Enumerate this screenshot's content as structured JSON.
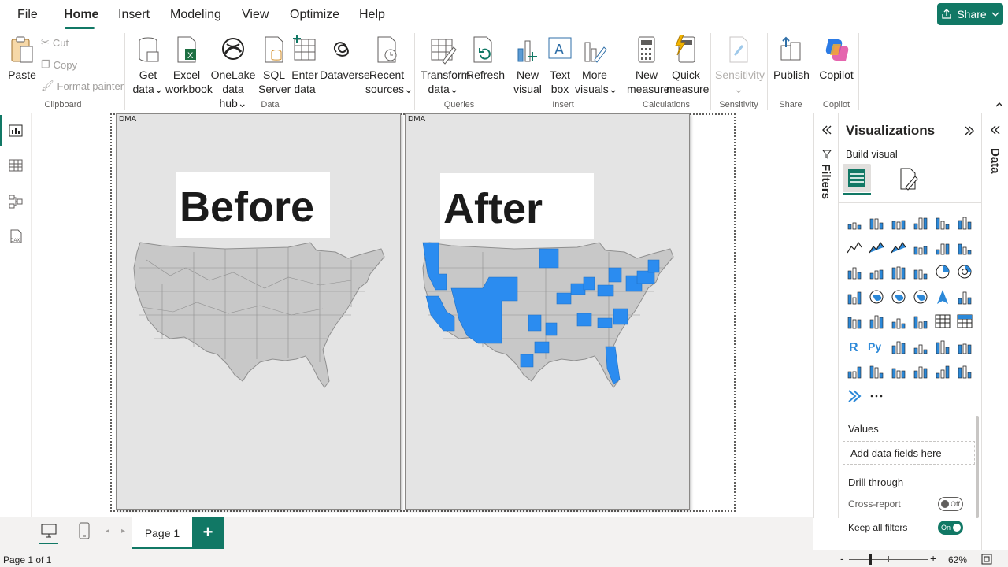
{
  "menu": {
    "file": "File",
    "home": "Home",
    "insert": "Insert",
    "modeling": "Modeling",
    "view": "View",
    "optimize": "Optimize",
    "help": "Help",
    "share": "Share"
  },
  "ribbon": {
    "paste": "Paste",
    "cut": "Cut",
    "copy": "Copy",
    "format_painter": "Format painter",
    "clipboard": "Clipboard",
    "get_data_1": "Get",
    "get_data_2": "data",
    "excel_1": "Excel",
    "excel_2": "workbook",
    "onelake_1": "OneLake",
    "onelake_2": "data hub",
    "sql_1": "SQL",
    "sql_2": "Server",
    "enter_1": "Enter",
    "enter_2": "data",
    "dataverse": "Dataverse",
    "recent_1": "Recent",
    "recent_2": "sources",
    "data_group": "Data",
    "transform_1": "Transform",
    "transform_2": "data",
    "refresh": "Refresh",
    "queries": "Queries",
    "new_visual_1": "New",
    "new_visual_2": "visual",
    "text_box_1": "Text",
    "text_box_2": "box",
    "more_visuals_1": "More",
    "more_visuals_2": "visuals",
    "insert_group": "Insert",
    "new_measure_1": "New",
    "new_measure_2": "measure",
    "quick_measure_1": "Quick",
    "quick_measure_2": "measure",
    "calculations": "Calculations",
    "sensitivity": "Sensitivity",
    "sensitivity_group": "Sensitivity",
    "publish": "Publish",
    "share_group": "Share",
    "copilot": "Copilot",
    "copilot_group": "Copilot"
  },
  "visuals": {
    "left": {
      "title": "DMA",
      "label": "Before"
    },
    "right": {
      "title": "DMA",
      "label": "After"
    }
  },
  "panes": {
    "filters": "Filters",
    "visualizations": "Visualizations",
    "build_visual": "Build visual",
    "data": "Data",
    "values": "Values",
    "add_data": "Add data fields here",
    "drill_through": "Drill through",
    "cross_report": "Cross-report",
    "cross_report_state": "Off",
    "keep_filters": "Keep all filters",
    "keep_filters_state": "On"
  },
  "bottom": {
    "page_tab": "Page 1",
    "status": "Page 1 of 1",
    "zoom": "62%"
  },
  "colors": {
    "accent": "#117865",
    "map_gray": "#c8c8c8",
    "map_highlight": "#2b8cf0"
  }
}
